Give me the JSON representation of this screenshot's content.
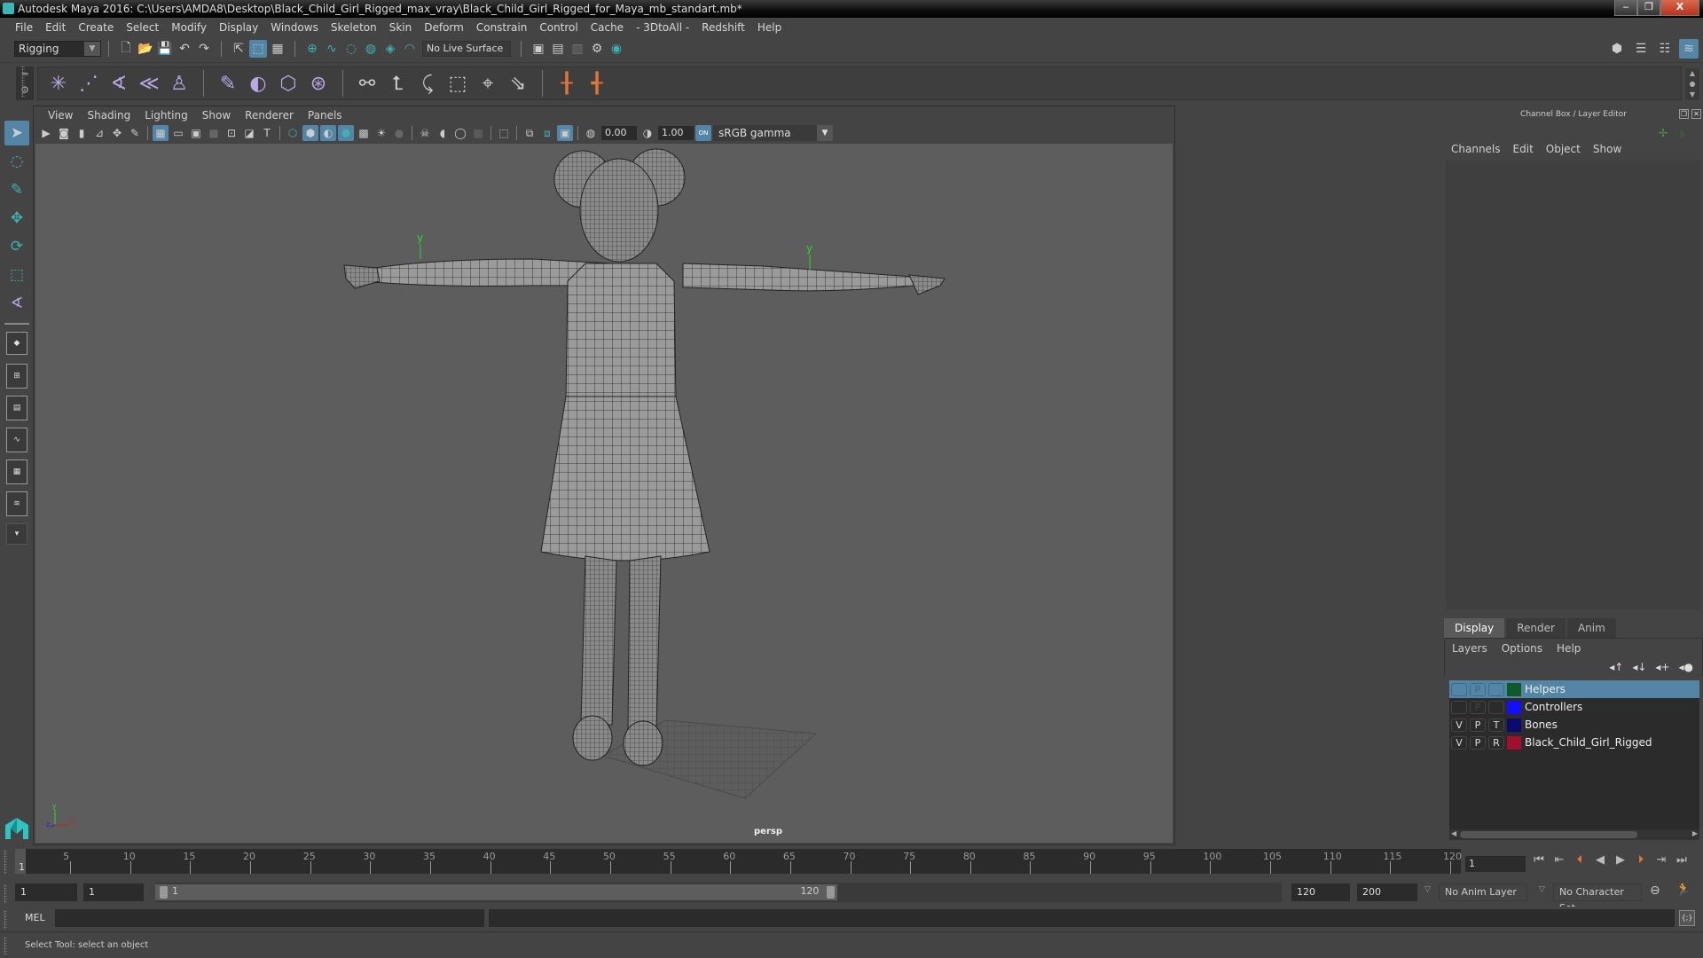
{
  "window": {
    "title": "Autodesk Maya 2016: C:\\Users\\AMDA8\\Desktop\\Black_Child_Girl_Rigged_max_vray\\Black_Child_Girl_Rigged_for_Maya_mb_standart.mb*",
    "minimize": "‒",
    "restore": "❐",
    "close": "X"
  },
  "menubar": [
    "File",
    "Edit",
    "Create",
    "Select",
    "Modify",
    "Display",
    "Windows",
    "Skeleton",
    "Skin",
    "Deform",
    "Constrain",
    "Control",
    "Cache",
    "- 3DtoAll -",
    "Redshift",
    "Help"
  ],
  "statusline": {
    "mode": "Rigging",
    "live_surface": "No Live Surface"
  },
  "viewport": {
    "menu": [
      "View",
      "Shading",
      "Lighting",
      "Show",
      "Renderer",
      "Panels"
    ],
    "exposure": "0.00",
    "gamma_value": "1.00",
    "color_mgmt_toggle": "ON",
    "color_space": "sRGB gamma",
    "camera": "persp",
    "axis_labels": {
      "x": "x",
      "y": "y",
      "z": "z"
    }
  },
  "channel_box": {
    "title": "Channel Box / Layer Editor",
    "menu": [
      "Channels",
      "Edit",
      "Object",
      "Show"
    ]
  },
  "layer_editor": {
    "tabs": [
      "Display",
      "Render",
      "Anim"
    ],
    "active_tab": "Display",
    "menu": [
      "Layers",
      "Options",
      "Help"
    ],
    "layers": [
      {
        "v": "",
        "p": "P",
        "t": "",
        "name": "Helpers",
        "color": "#0f5a28",
        "selected": true
      },
      {
        "v": "",
        "p": "P",
        "t": "",
        "name": "Controllers",
        "color": "#1010ff",
        "selected": false
      },
      {
        "v": "V",
        "p": "P",
        "t": "T",
        "name": "Bones",
        "color": "#0a0a70",
        "selected": false
      },
      {
        "v": "V",
        "p": "P",
        "t": "R",
        "name": "Black_Child_Girl_Rigged",
        "color": "#a0102e",
        "selected": false
      }
    ]
  },
  "timeslider": {
    "ticks": [
      5,
      10,
      15,
      20,
      25,
      30,
      35,
      40,
      45,
      50,
      55,
      60,
      65,
      70,
      75,
      80,
      85,
      90,
      95,
      100,
      105,
      110,
      115,
      120
    ],
    "current_frame_marker": "1",
    "current_frame": "1",
    "range_min": 1,
    "range_max": 120
  },
  "range": {
    "start": "1",
    "playback_start": "1",
    "slider_start_label": "1",
    "slider_end_label": "120",
    "playback_end": "120",
    "end": "200",
    "anim_layer": "No Anim Layer",
    "character_set": "No Character Set"
  },
  "command_line": {
    "label": "MEL"
  },
  "help_line": "Select Tool: select an object",
  "colors": {
    "accent": "#5285a6",
    "teal": "#3fb0b0",
    "orange": "#e2743a",
    "shelf_purple": "#b8a8e6"
  }
}
